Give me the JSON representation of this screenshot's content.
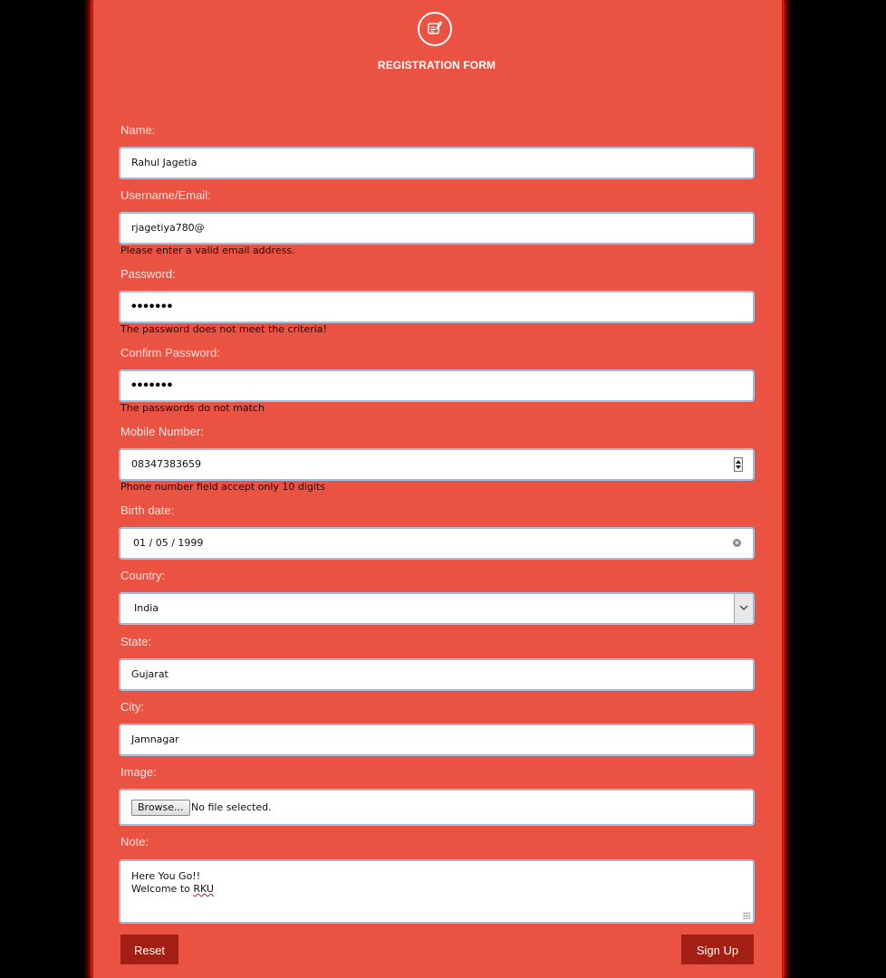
{
  "header": {
    "title": "REGISTRATION FORM",
    "logo_icon": "form-edit-icon"
  },
  "fields": {
    "name": {
      "label": "Name:",
      "value": "Rahul Jagetia"
    },
    "username": {
      "label": "Username/Email:",
      "value": "rjagetiya780@",
      "error": "Please enter a valid email address."
    },
    "password": {
      "label": "Password:",
      "masked": "•••••••",
      "error": "The password does not meet the criteria!"
    },
    "confirm_password": {
      "label": "Confirm Password:",
      "masked": "•••••••",
      "error": "The passwords do not match"
    },
    "mobile": {
      "label": "Mobile Number:",
      "value": "08347383659",
      "error": "Phone number field accept only 10 digits"
    },
    "birth_date": {
      "label": "Birth date:",
      "value": "01 / 05 / 1999"
    },
    "country": {
      "label": "Country:",
      "value": "India"
    },
    "state": {
      "label": "State:",
      "value": "Gujarat"
    },
    "city": {
      "label": "City:",
      "value": "Jamnagar"
    },
    "image": {
      "label": "Image:",
      "browse_label": "Browse...",
      "status": "No file selected."
    },
    "note": {
      "label": "Note:",
      "line1": "Here You Go!!",
      "line2_prefix": "Welcome to ",
      "line2_flagged": "RKU"
    }
  },
  "buttons": {
    "reset": "Reset",
    "signup": "Sign Up"
  },
  "colors": {
    "background": "#000000",
    "panel": "#ea5242",
    "button": "#a31f13",
    "error_text": "#2a0808"
  }
}
